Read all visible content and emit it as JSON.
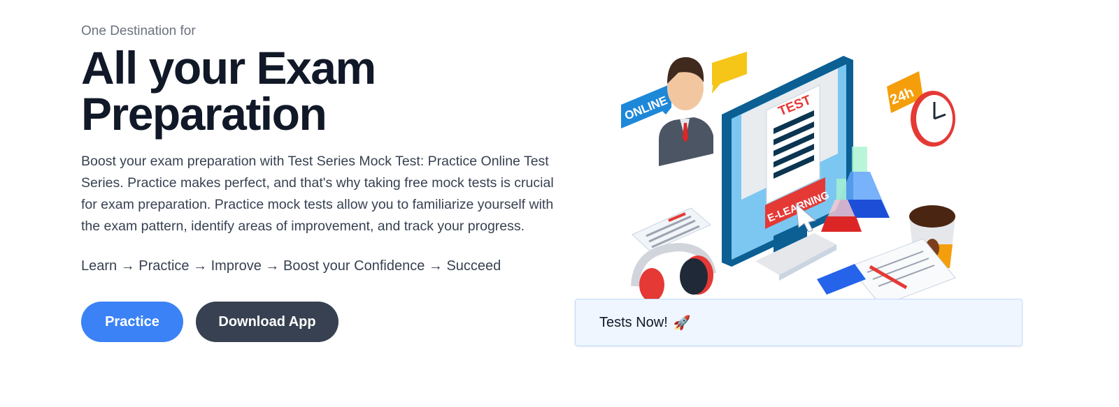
{
  "hero": {
    "eyebrow": "One Destination for",
    "title_line1": "All your Exam",
    "title_line2": "Preparation",
    "description": "Boost your exam preparation with Test Series Mock Test: Practice Online Test Series. Practice makes perfect, and that's why taking free mock tests is crucial for exam preparation. Practice mock tests allow you to familiarize yourself with the exam pattern, identify areas of improvement, and track your progress.",
    "steps": "Learn → Practice → Improve → Boost your Confidence → Succeed",
    "practice_label": "Practice",
    "download_label": "Download App"
  },
  "illustration": {
    "online_label": "ONLINE",
    "test_label": "TEST",
    "elearning_label": "E-LEARNING",
    "clock_label": "24h"
  },
  "toast": {
    "text": "Tests Now!",
    "icon": "🚀"
  },
  "colors": {
    "primary": "#3b82f6",
    "dark": "#374151",
    "toast_bg": "#eff6ff"
  }
}
